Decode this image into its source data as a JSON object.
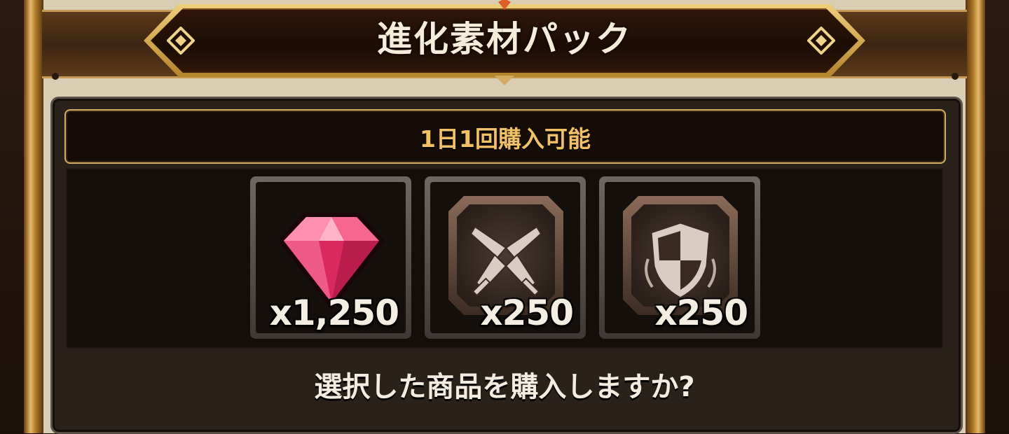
{
  "header": {
    "title": "進化素材パック"
  },
  "purchase_limit": {
    "text": "1日1回購入可能"
  },
  "items": [
    {
      "icon": "pink-gem-icon",
      "quantity": "x1,250"
    },
    {
      "icon": "crossed-swords-icon",
      "quantity": "x250"
    },
    {
      "icon": "checkered-shield-icon",
      "quantity": "x250"
    }
  ],
  "confirm": {
    "question": "選択した商品を購入しますか?"
  },
  "colors": {
    "gold_accent": "#d5ad62",
    "limit_text": "#f2c066",
    "gem_pink": "#e8447a",
    "panel_dark": "#2a211b"
  }
}
